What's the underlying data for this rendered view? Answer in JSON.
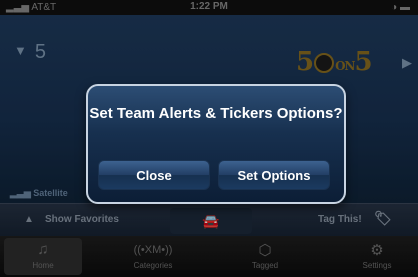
{
  "status": {
    "carrier": "AT&T",
    "time": "1:22 PM"
  },
  "player": {
    "channel_number": "5",
    "channel_logo": "5 ON 5",
    "now_playing": "",
    "signal_source": "Satellite"
  },
  "action_bar": {
    "show_favorites": "Show Favorites",
    "tag_this": "Tag This!"
  },
  "tabs": [
    {
      "label": "Home",
      "icon": "music-note-icon",
      "active": true
    },
    {
      "label": "Categories",
      "icon": "xm-logo-icon",
      "active": false
    },
    {
      "label": "Tagged",
      "icon": "tag-icon",
      "active": false
    },
    {
      "label": "Settings",
      "icon": "gear-icon",
      "active": false
    }
  ],
  "dialog": {
    "title": "Set Team Alerts & Tickers Options?",
    "close_label": "Close",
    "set_options_label": "Set Options"
  }
}
